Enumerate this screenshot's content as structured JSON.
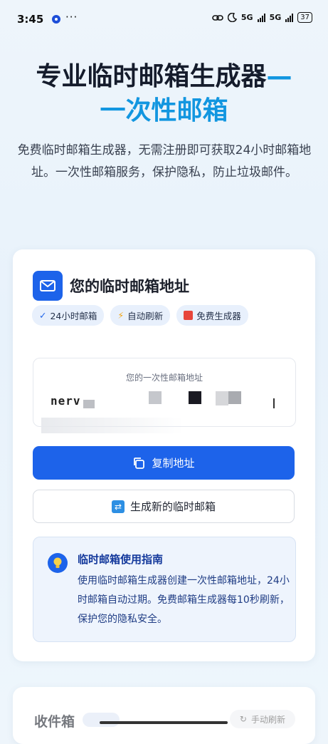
{
  "status_bar": {
    "time": "3:45",
    "dots": "···",
    "network_1": "5G",
    "network_2": "5G",
    "battery": "37"
  },
  "hero": {
    "title_main": "专业临时邮箱生成器",
    "title_dash": "—",
    "title_highlight": "次性邮箱",
    "title_prefix_line2": "一",
    "subtitle": "免费临时邮箱生成器，无需注册即可获取24小时邮箱地址。一次性邮箱服务，保护隐私，防止垃圾邮件。"
  },
  "card": {
    "title": "您的临时邮箱地址",
    "tags": [
      {
        "icon": "check-icon",
        "label": "24小时邮箱"
      },
      {
        "icon": "lightning-icon",
        "label": "自动刷新"
      },
      {
        "icon": "gift-icon",
        "label": "免费生成器"
      }
    ],
    "address_label": "您的一次性邮箱地址",
    "address_value_visible": "nerv",
    "copy_button": "复制地址",
    "new_button": "生成新的临时邮箱"
  },
  "guide": {
    "title": "临时邮箱使用指南",
    "text": "使用临时邮箱生成器创建一次性邮箱地址，24小时邮箱自动过期。免费邮箱生成器每10秒刷新，保护您的隐私安全。"
  },
  "inbox": {
    "title": "收件箱",
    "refresh_button": "手动刷新"
  },
  "colors": {
    "accent": "#1d63ea",
    "highlight": "#1296e0",
    "guide_bg": "#eef4fd"
  }
}
